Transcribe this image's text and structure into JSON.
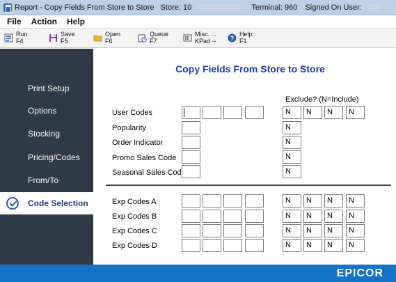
{
  "window": {
    "title_prefix": "Report - Copy Fields From Store to Store",
    "store_label": "Store: 10",
    "terminal_label": "Terminal: 960",
    "signed_on_label": "Signed On User:"
  },
  "menu": [
    "File",
    "Action",
    "Help"
  ],
  "toolbar": [
    {
      "name": "run",
      "label": "Run",
      "key": "F4",
      "icon": "run-icon"
    },
    {
      "name": "save",
      "label": "Save",
      "key": "F5",
      "icon": "save-icon"
    },
    {
      "name": "open",
      "label": "Open",
      "key": "F6",
      "icon": "folder-icon"
    },
    {
      "name": "queue",
      "label": "Queue",
      "key": "F7",
      "icon": "queue-icon"
    },
    {
      "name": "misc",
      "label": "Misc. ...",
      "key": "KPad --",
      "icon": "keypad-icon"
    },
    {
      "name": "help",
      "label": "Help",
      "key": "F1",
      "icon": "help-icon"
    }
  ],
  "sidebar": [
    {
      "label": "Print Setup",
      "active": false
    },
    {
      "label": "Options",
      "active": false
    },
    {
      "label": "Stocking",
      "active": false
    },
    {
      "label": "Pricing/Codes",
      "active": false
    },
    {
      "label": "From/To",
      "active": false
    },
    {
      "label": "Code Selection",
      "active": true
    }
  ],
  "main": {
    "title": "Copy Fields From Store to Store",
    "exclude_label": "Exclude? (N=Include)",
    "rows": [
      {
        "label": "User Codes",
        "inputs": 4,
        "excludes": [
          "N",
          "N",
          "N",
          "N"
        ]
      },
      {
        "label": "Popularity",
        "inputs": 1,
        "excludes": [
          "N"
        ]
      },
      {
        "label": "Order Indicator",
        "inputs": 1,
        "excludes": [
          "N"
        ]
      },
      {
        "label": "Promo Sales Code",
        "inputs": 1,
        "excludes": [
          "N"
        ]
      },
      {
        "label": "Seasonal Sales Code",
        "inputs": 1,
        "excludes": [
          "N"
        ]
      },
      {
        "label": "Exp Codes A",
        "inputs": 4,
        "excludes": [
          "N",
          "N",
          "N",
          "N"
        ]
      },
      {
        "label": "Exp Codes B",
        "inputs": 4,
        "excludes": [
          "N",
          "N",
          "N",
          "N"
        ]
      },
      {
        "label": "Exp Codes C",
        "inputs": 4,
        "excludes": [
          "N",
          "N",
          "N",
          "N"
        ]
      },
      {
        "label": "Exp Codes D",
        "inputs": 4,
        "excludes": [
          "N",
          "N",
          "N",
          "N"
        ]
      }
    ]
  },
  "footer": {
    "brand": "EPICOR"
  },
  "colors": {
    "sidebar": "#2f3a48",
    "accent": "#1e3aa8",
    "footer": "#1473c7"
  }
}
